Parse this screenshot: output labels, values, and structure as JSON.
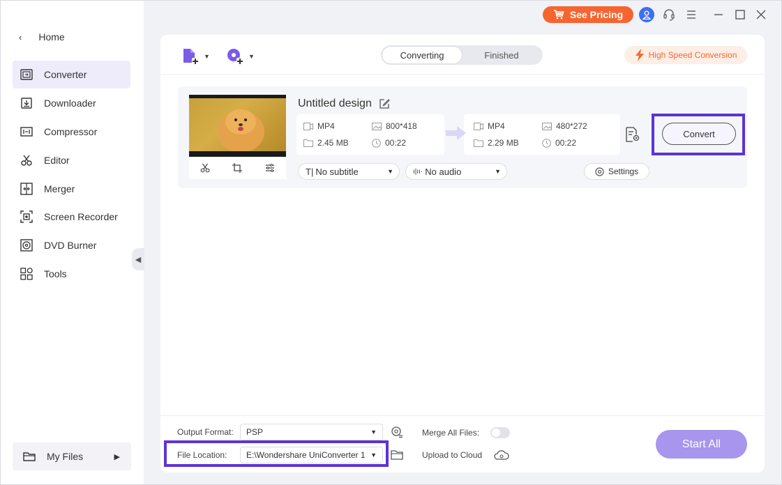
{
  "titlebar": {
    "pricing_label": "See Pricing"
  },
  "sidebar": {
    "home_label": "Home",
    "items": [
      {
        "label": "Converter",
        "icon": "converter-icon",
        "active": true
      },
      {
        "label": "Downloader",
        "icon": "downloader-icon"
      },
      {
        "label": "Compressor",
        "icon": "compressor-icon"
      },
      {
        "label": "Editor",
        "icon": "scissors-icon"
      },
      {
        "label": "Merger",
        "icon": "merger-icon"
      },
      {
        "label": "Screen Recorder",
        "icon": "screen-recorder-icon"
      },
      {
        "label": "DVD Burner",
        "icon": "disc-icon"
      },
      {
        "label": "Tools",
        "icon": "grid-icon"
      }
    ],
    "myfiles_label": "My Files"
  },
  "toolbar": {
    "tabs": [
      "Converting",
      "Finished"
    ],
    "active_tab": "Converting",
    "hsc_label": "High Speed Conversion"
  },
  "file": {
    "title": "Untitled design",
    "source": {
      "format": "MP4",
      "resolution": "800*418",
      "size": "2.45 MB",
      "duration": "00:22"
    },
    "target": {
      "format": "MP4",
      "resolution": "480*272",
      "size": "2.29 MB",
      "duration": "00:22"
    },
    "convert_label": "Convert",
    "subtitle": "No subtitle",
    "audio": "No audio",
    "settings_label": "Settings"
  },
  "bottom": {
    "output_format_label": "Output Format:",
    "output_format_value": "PSP",
    "file_location_label": "File Location:",
    "file_location_value": "E:\\Wondershare UniConverter 1",
    "merge_label": "Merge All Files:",
    "upload_label": "Upload to Cloud",
    "start_all_label": "Start All"
  },
  "colors": {
    "accent": "#5b34d6",
    "pricing": "#f6652f",
    "start_all": "#a795ee",
    "hsc": "#f26a2e"
  }
}
